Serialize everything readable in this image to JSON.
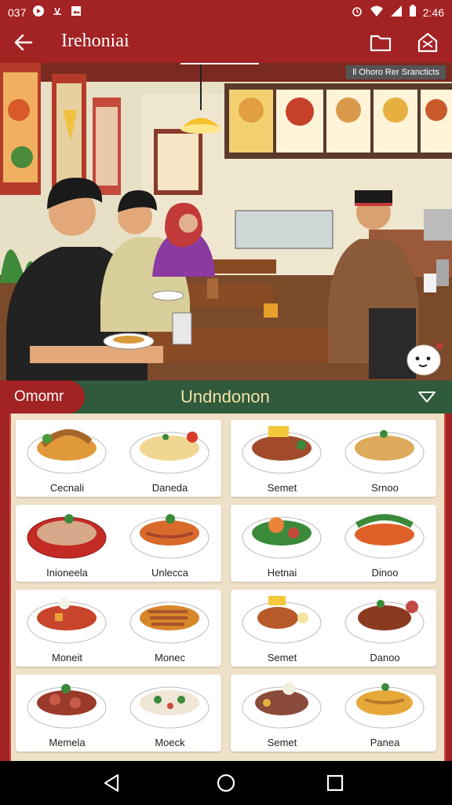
{
  "status": {
    "time_left": "037",
    "time_right": "2:46"
  },
  "appbar": {
    "title": "Irehoniai"
  },
  "hero": {
    "tag": "ll Ohoro Rer Srancticts"
  },
  "category": {
    "chip": "Omomr",
    "current": "Undndonon"
  },
  "menu": {
    "cards": [
      {
        "items": [
          {
            "name": "Cecnali"
          },
          {
            "name": "Daneda"
          }
        ]
      },
      {
        "items": [
          {
            "name": "Semet"
          },
          {
            "name": "Srnoo"
          }
        ]
      },
      {
        "items": [
          {
            "name": "Inioneela"
          },
          {
            "name": "Unlecca"
          }
        ]
      },
      {
        "items": [
          {
            "name": "Hetnai"
          },
          {
            "name": "Dinoo"
          }
        ]
      },
      {
        "items": [
          {
            "name": "Moneit"
          },
          {
            "name": "Monec"
          }
        ]
      },
      {
        "items": [
          {
            "name": "Semet"
          },
          {
            "name": "Danoo"
          }
        ]
      },
      {
        "items": [
          {
            "name": "Memela"
          },
          {
            "name": "Moeck"
          }
        ]
      },
      {
        "items": [
          {
            "name": "Semet"
          },
          {
            "name": "Panea"
          }
        ]
      }
    ]
  },
  "colors": {
    "primary": "#a32224",
    "category_bar": "#2f5a3c",
    "grid_bg": "#efe0c8"
  },
  "icons": [
    "back-arrow-icon",
    "folder-icon",
    "share-icon",
    "chevron-down-icon",
    "chat-icon",
    "nav-back-icon",
    "nav-home-icon",
    "nav-recents-icon"
  ]
}
